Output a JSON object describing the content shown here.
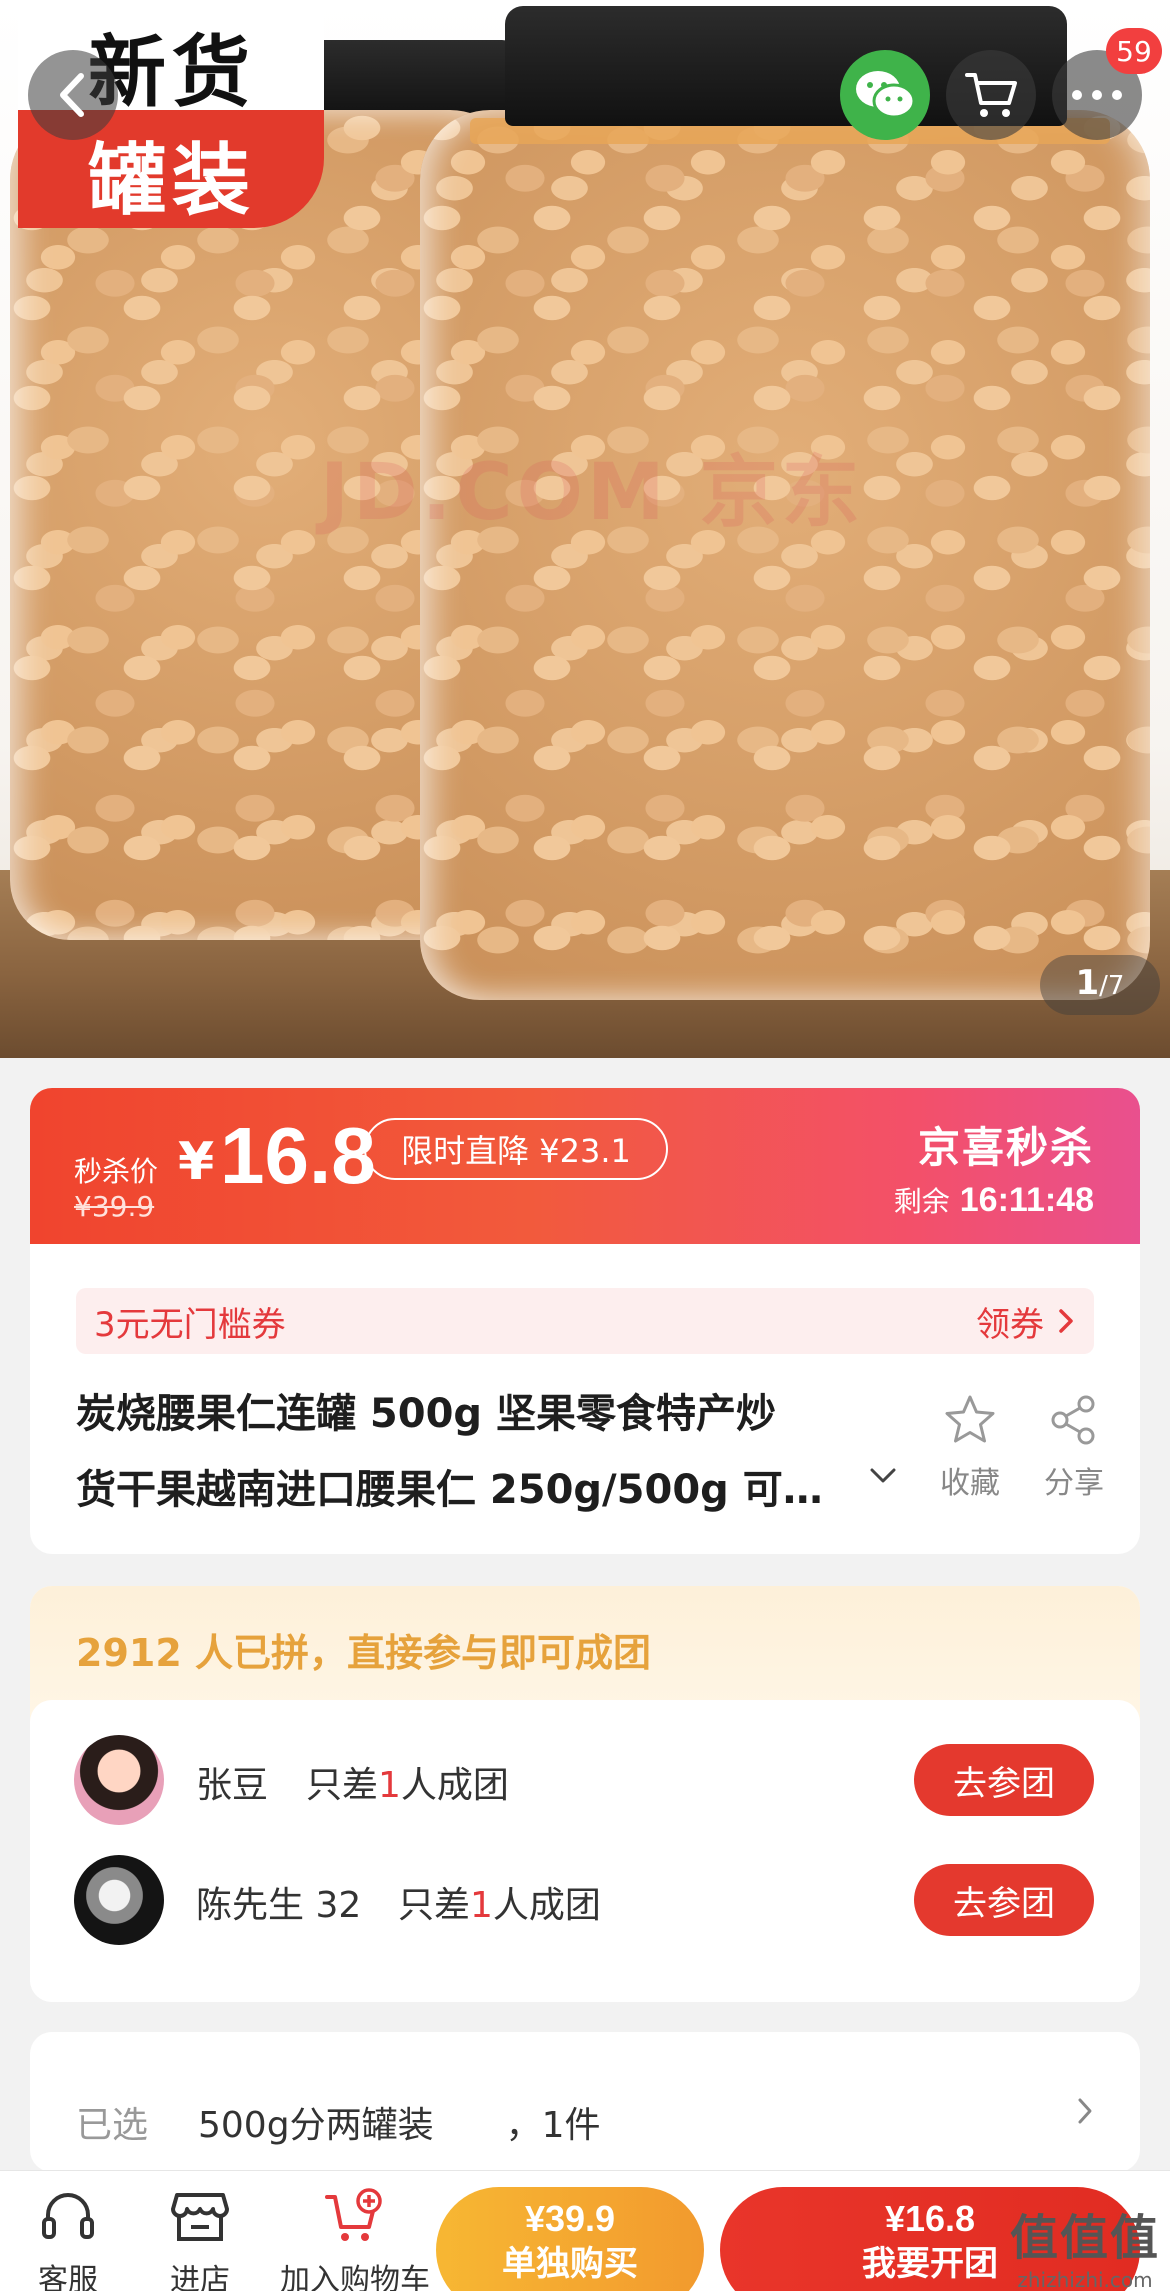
{
  "hero": {
    "promo_line1": "新货",
    "promo_line2": "罐装",
    "watermark": "JD.COM 京东",
    "cart_badge": "59",
    "image_index": "1",
    "image_total": "/7"
  },
  "price": {
    "label": "秒杀价",
    "currency": "¥",
    "current": "16.8",
    "original": "¥39.9",
    "drop_text": "限时直降 ¥23.1",
    "brand": "京喜秒杀",
    "remaining_label": "剩余",
    "countdown": "16:11:48"
  },
  "coupon": {
    "text": "3元无门槛券",
    "claim": "领券"
  },
  "product": {
    "title_line1": "炭烧腰果仁连罐 500g 坚果零食特产炒",
    "title_line2": "货干果越南进口腰果仁 250g/500g 可…",
    "favorite_label": "收藏",
    "share_label": "分享"
  },
  "group": {
    "headline": "2912 人已拼，直接参与即可成团",
    "members": [
      {
        "name": "张豆",
        "need_prefix": "只差",
        "need_count": "1",
        "need_suffix": "人成团",
        "button": "去参团"
      },
      {
        "name": "陈先生 32",
        "need_prefix": "只差",
        "need_count": "1",
        "need_suffix": "人成团",
        "button": "去参团"
      }
    ]
  },
  "selection": {
    "label": "已选",
    "value": "500g分两罐装　　，1件"
  },
  "bottom_bar": {
    "service": "客服",
    "store": "进店",
    "add_cart": "加入购物车",
    "single_price": "¥39.9",
    "single_label": "单独购买",
    "group_price": "¥16.8",
    "group_label": "我要开团"
  },
  "corner_watermark": {
    "big": "值值值",
    "small": "zhizhizhi.com"
  },
  "colors": {
    "accent_red": "#e4393c",
    "wechat_green": "#3fb34a",
    "group_gold": "#e6a23c",
    "single_orange": "#f7b733"
  }
}
